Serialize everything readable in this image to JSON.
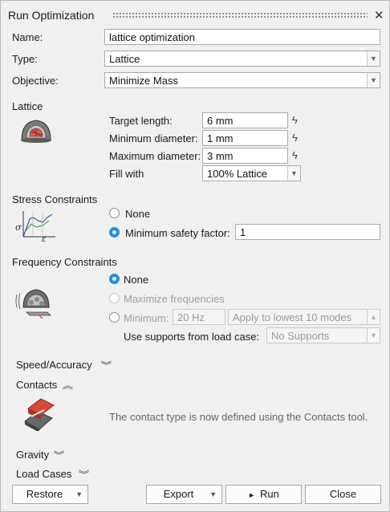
{
  "window": {
    "title": "Run Optimization",
    "close_icon": "✕"
  },
  "form": {
    "name_label": "Name:",
    "name_value": "lattice optimization",
    "type_label": "Type:",
    "type_value": "Lattice",
    "objective_label": "Objective:",
    "objective_value": "Minimize Mass"
  },
  "lattice": {
    "heading": "Lattice",
    "target_length_label": "Target length:",
    "target_length_value": "6 mm",
    "min_diameter_label": "Minimum diameter:",
    "min_diameter_value": "1 mm",
    "max_diameter_label": "Maximum diameter:",
    "max_diameter_value": "3 mm",
    "fill_label": "Fill with",
    "fill_value": "100% Lattice"
  },
  "stress": {
    "heading": "Stress Constraints",
    "none_label": "None",
    "min_sf_label": "Minimum safety factor:",
    "min_sf_value": "1",
    "selected": "minimum_safety_factor"
  },
  "frequency": {
    "heading": "Frequency Constraints",
    "none_label": "None",
    "maximize_label": "Maximize frequencies",
    "minimum_label": "Minimum:",
    "minimum_value": "20 Hz",
    "apply_value": "Apply to lowest 10 modes",
    "supports_label": "Use supports from load case:",
    "supports_value": "No Supports",
    "selected": "none"
  },
  "sections": {
    "speed_accuracy": "Speed/Accuracy",
    "contacts": "Contacts",
    "contacts_note": "The contact type is now defined using the Contacts tool.",
    "gravity": "Gravity",
    "load_cases": "Load Cases"
  },
  "footer": {
    "restore": "Restore",
    "export": "Export",
    "run": "Run",
    "close": "Close",
    "run_icon": "►"
  },
  "colors": {
    "accent": "#1f8fe0",
    "background": "#f0f0f0"
  }
}
